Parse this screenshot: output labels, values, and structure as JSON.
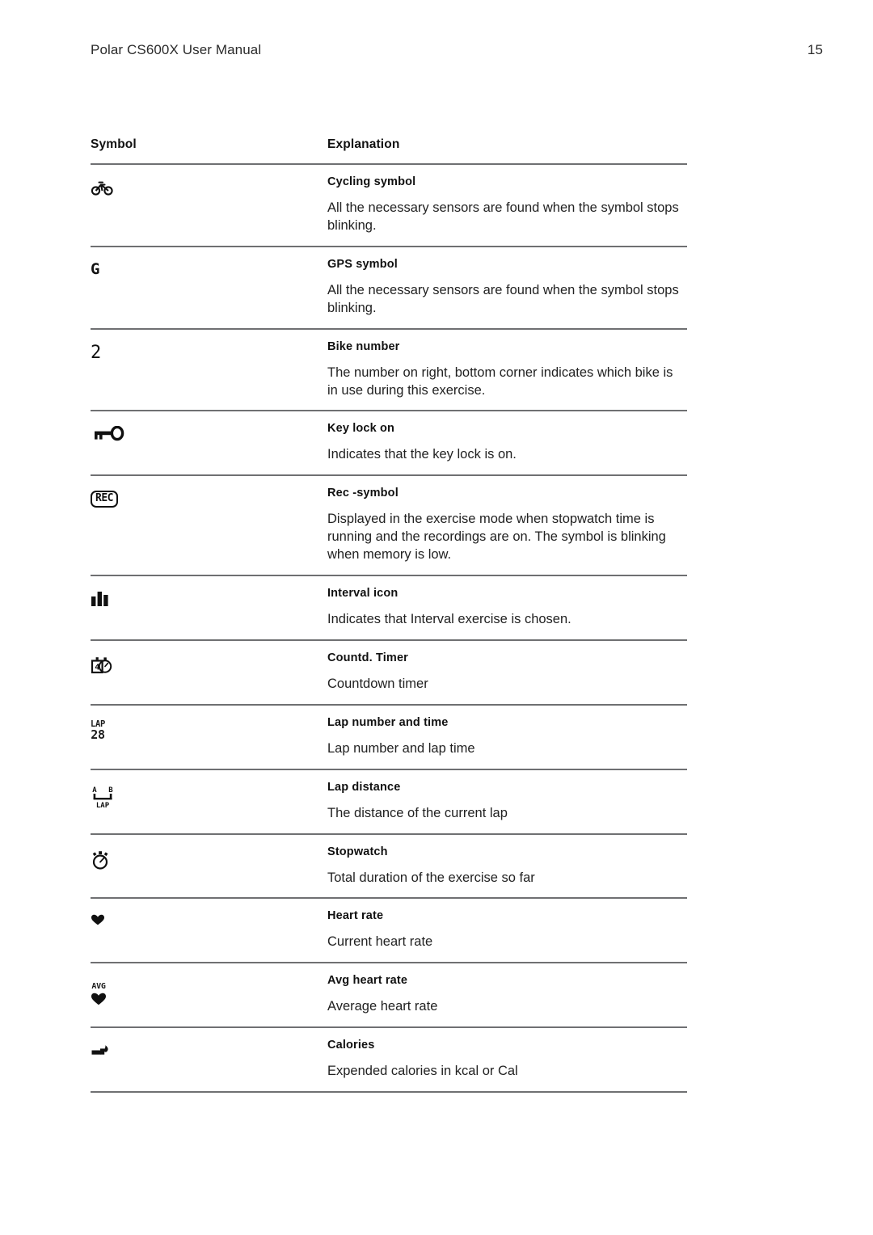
{
  "header": {
    "title": "Polar CS600X User Manual",
    "page_number": "15"
  },
  "table": {
    "columns": {
      "symbol": "Symbol",
      "explanation": "Explanation"
    },
    "rows": [
      {
        "icon": "bicycle-icon",
        "title": "Cycling symbol",
        "body": "All the necessary sensors are found when the symbol stops blinking."
      },
      {
        "icon": "gps-g-icon",
        "icon_text": "G",
        "title": "GPS symbol",
        "body": "All the necessary sensors are found when the symbol stops blinking."
      },
      {
        "icon": "bike-number-icon",
        "icon_text": "2",
        "title": "Bike number",
        "body": "The number on right, bottom corner indicates which bike is in use during this exercise."
      },
      {
        "icon": "key-lock-icon",
        "title": "Key lock on",
        "body": "Indicates that the key lock is on."
      },
      {
        "icon": "rec-icon",
        "icon_text": "REC",
        "title": "Rec -symbol",
        "body": "Displayed in the exercise mode when stopwatch time is running and the recordings are on. The symbol is blinking when memory is low."
      },
      {
        "icon": "interval-bars-icon",
        "title": "Interval icon",
        "body": "Indicates that Interval exercise is chosen."
      },
      {
        "icon": "countdown-timer-icon",
        "title": "Countd. Timer",
        "body": "Countdown timer"
      },
      {
        "icon": "lap-number-icon",
        "icon_text_top": "LAP",
        "icon_text_bottom": "28",
        "title": "Lap number and time",
        "body": "Lap number and lap time"
      },
      {
        "icon": "lap-distance-icon",
        "icon_text_a": "A",
        "icon_text_b": "B",
        "icon_text_bottom": "LAP",
        "title": "Lap distance",
        "body": "The distance of the current lap"
      },
      {
        "icon": "stopwatch-icon",
        "title": "Stopwatch",
        "body": "Total duration of the exercise so far"
      },
      {
        "icon": "heart-icon",
        "title": "Heart rate",
        "body": "Current heart rate"
      },
      {
        "icon": "avg-heart-icon",
        "icon_text_top": "AVG",
        "title": "Avg heart rate",
        "body": "Average heart rate"
      },
      {
        "icon": "calories-flame-icon",
        "title": "Calories",
        "body": "Expended calories in kcal or Cal"
      }
    ]
  },
  "colors": {
    "text": "#1a1a1a",
    "rule": "#6f7072",
    "page_background": "#ffffff"
  }
}
